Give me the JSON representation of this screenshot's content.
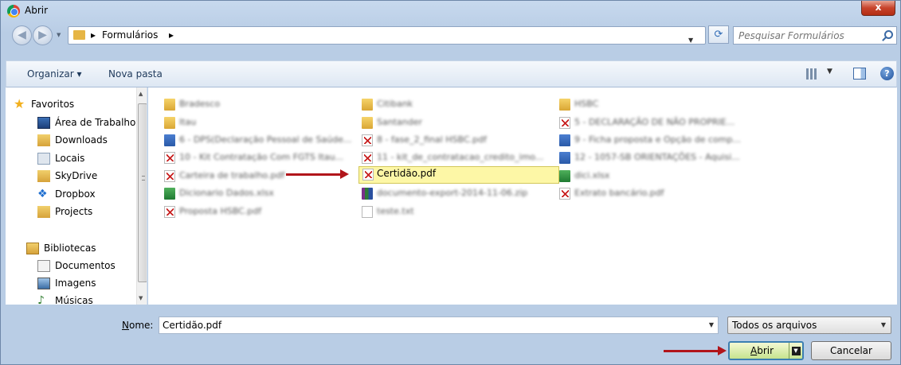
{
  "window": {
    "title": "Abrir",
    "close": "x"
  },
  "nav": {
    "breadcrumb_sep": "▸",
    "breadcrumb": [
      "Formulários"
    ],
    "search_placeholder": "Pesquisar Formulários"
  },
  "toolbar": {
    "organize": "Organizar ▾",
    "new_folder": "Nova pasta",
    "help": "?"
  },
  "sidebar": {
    "items": [
      {
        "label": "Favoritos",
        "icon": "star-icon"
      },
      {
        "label": "Área de Trabalho",
        "icon": "desktop-icon"
      },
      {
        "label": "Downloads",
        "icon": "downloads-icon"
      },
      {
        "label": "Locais",
        "icon": "places-icon"
      },
      {
        "label": "SkyDrive",
        "icon": "folder-icon"
      },
      {
        "label": "Dropbox",
        "icon": "dropbox-icon"
      },
      {
        "label": "Projects",
        "icon": "folder-icon"
      },
      {
        "label": "Bibliotecas",
        "icon": "libraries-icon"
      },
      {
        "label": "Documentos",
        "icon": "documents-icon"
      },
      {
        "label": "Imagens",
        "icon": "images-icon"
      },
      {
        "label": "Músicas",
        "icon": "music-icon"
      }
    ]
  },
  "files": [
    {
      "name": "Bradesco",
      "type": "folder"
    },
    {
      "name": "Itau",
      "type": "folder"
    },
    {
      "name": "6 - DPS(Declaração Pessoal de Saúde...",
      "type": "word"
    },
    {
      "name": "10 - Kit Contratação Com FGTS Itau...",
      "type": "pdf"
    },
    {
      "name": "Carteira de trabalho.pdf",
      "type": "pdf"
    },
    {
      "name": "Dicionario Dados.xlsx",
      "type": "excel"
    },
    {
      "name": "Proposta HSBC.pdf",
      "type": "pdf"
    },
    {
      "name": "Citibank",
      "type": "folder"
    },
    {
      "name": "Santander",
      "type": "folder"
    },
    {
      "name": "8 - fase_2_final HSBC.pdf",
      "type": "pdf"
    },
    {
      "name": "11 - kit_de_contratacao_credito_imo...",
      "type": "pdf"
    },
    {
      "name": "Certidão.pdf",
      "type": "pdf",
      "selected": true
    },
    {
      "name": "documento-export-2014-11-06.zip",
      "type": "zip"
    },
    {
      "name": "teste.txt",
      "type": "txt"
    },
    {
      "name": "HSBC",
      "type": "folder"
    },
    {
      "name": "5 - DECLARAÇÃO DE NÃO PROPRIE...",
      "type": "pdf"
    },
    {
      "name": "9 - Ficha proposta e Opção de comp...",
      "type": "word"
    },
    {
      "name": "12 - 1057-SB ORIENTAÇÕES - Aquisi...",
      "type": "word"
    },
    {
      "name": "dici.xlsx",
      "type": "excel"
    },
    {
      "name": "Extrato bancário.pdf",
      "type": "pdf"
    }
  ],
  "bottom": {
    "name_label": "Nome:",
    "name_label_rest": "ome:",
    "name_value": "Certidão.pdf",
    "type_value": "Todos os arquivos",
    "open_label_rest": "brir",
    "open_label": "Abrir",
    "cancel_label": "Cancelar"
  }
}
